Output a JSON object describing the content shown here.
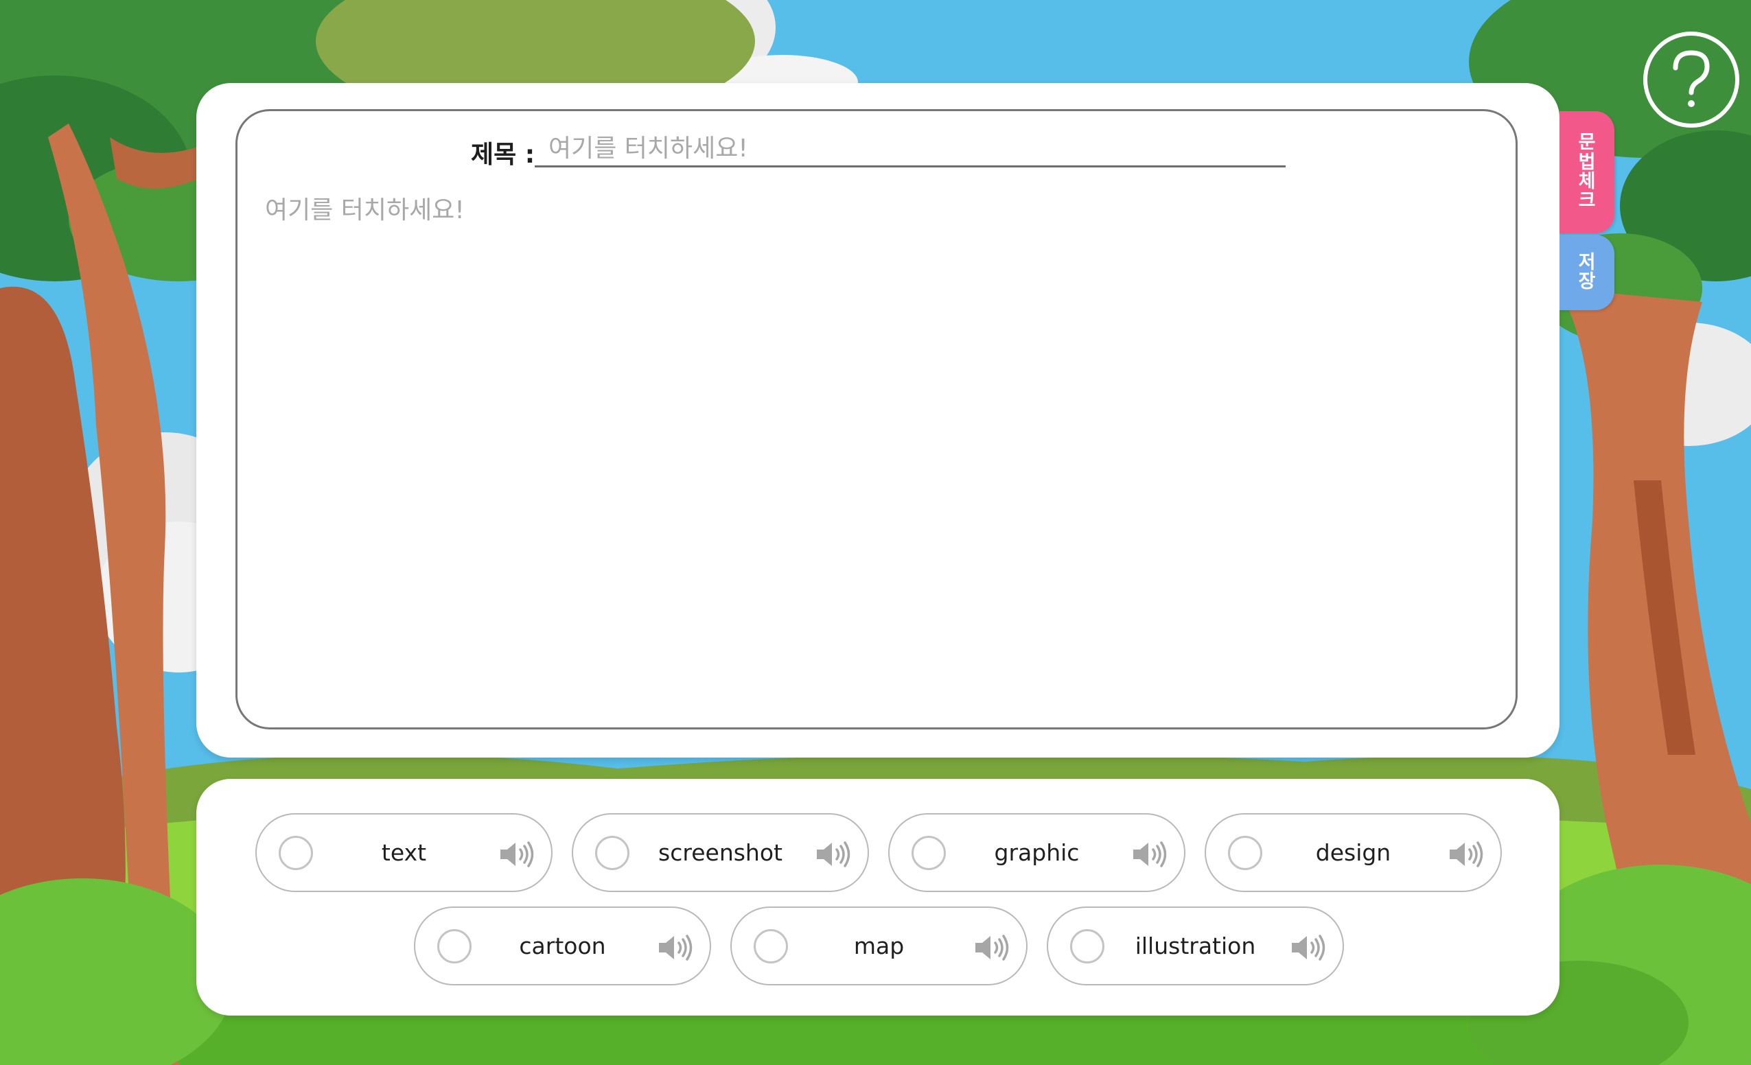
{
  "app": {
    "help_icon": "question-mark-circle-icon"
  },
  "writing": {
    "title_label": "제목 :",
    "title_placeholder": "여기를 터치하세요!",
    "body_placeholder": "여기를 터치하세요!"
  },
  "side_tabs": {
    "grammar_check": [
      "문",
      "법",
      "체",
      "크"
    ],
    "save": [
      "저",
      "장"
    ],
    "grammar_color": "#f3588a",
    "save_color": "#70a9ea"
  },
  "options": [
    {
      "word": "text",
      "icon": "speaker-icon"
    },
    {
      "word": "screenshot",
      "icon": "speaker-icon"
    },
    {
      "word": "graphic",
      "icon": "speaker-icon"
    },
    {
      "word": "design",
      "icon": "speaker-icon"
    },
    {
      "word": "cartoon",
      "icon": "speaker-icon"
    },
    {
      "word": "map",
      "icon": "speaker-icon"
    },
    {
      "word": "illustration",
      "icon": "speaker-icon"
    }
  ]
}
